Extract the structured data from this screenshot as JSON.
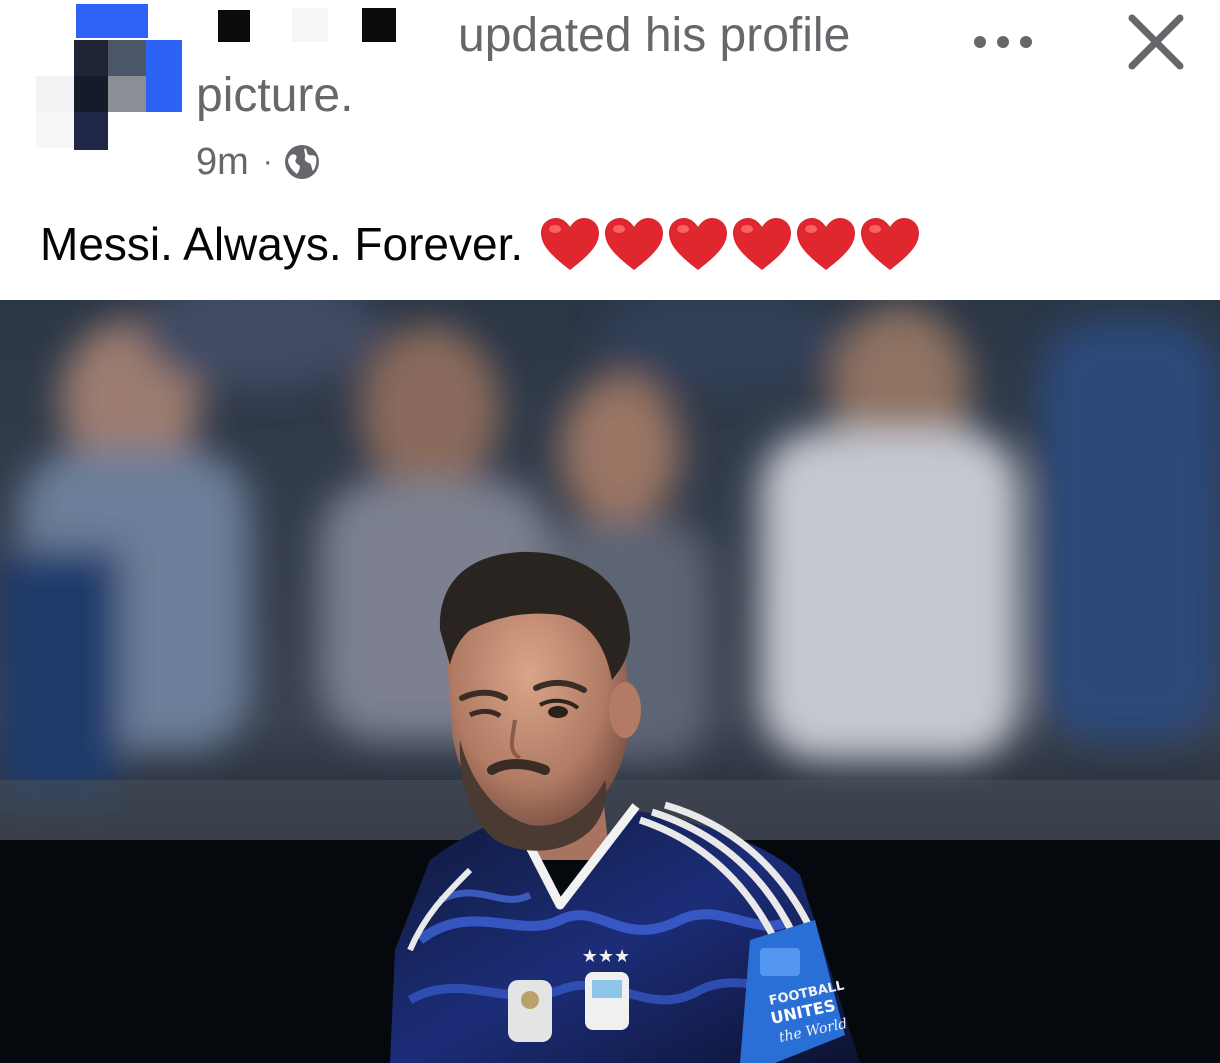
{
  "post": {
    "action_text": "updated his profile",
    "action_text_cont": "picture.",
    "time": "9m",
    "separator": "·",
    "audience_icon": "globe-icon",
    "caption": "Messi. Always. Forever.",
    "caption_emoji": [
      "❤️",
      "❤️",
      "❤️",
      "❤️",
      "❤️",
      "❤️"
    ],
    "menu_icon": "more-horizontal-icon",
    "close_icon": "close-icon"
  },
  "photo": {
    "armband_text": [
      "FOOTBALL",
      "UNITES",
      "the World"
    ]
  },
  "colors": {
    "secondary_text": "#65676b",
    "primary_text": "#050505",
    "heart": "#e0262e",
    "avatar_blue": "#2d63f5"
  }
}
